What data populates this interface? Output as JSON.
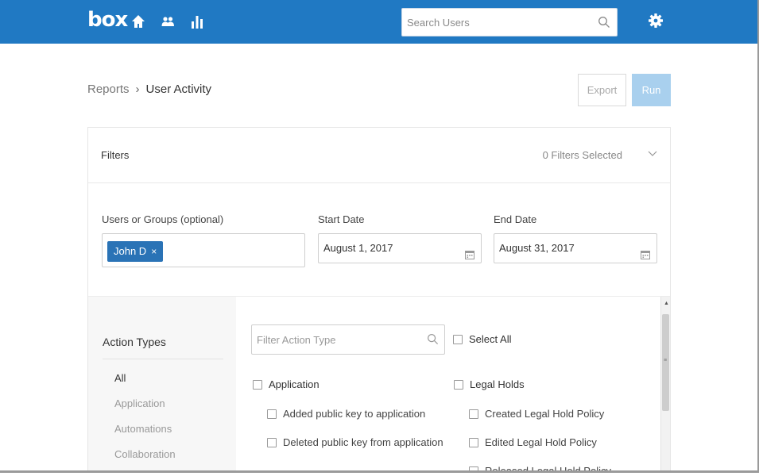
{
  "header": {
    "logo": "box",
    "search_placeholder": "Search Users",
    "icons": [
      "home-icon",
      "users-icon",
      "reports-icon",
      "gear-icon",
      "search-icon"
    ]
  },
  "breadcrumb": {
    "parent": "Reports",
    "separator": "›",
    "current": "User Activity"
  },
  "actions": {
    "export_label": "Export",
    "run_label": "Run"
  },
  "filters": {
    "title": "Filters",
    "selected_count": "0 Filters Selected",
    "users_label": "Users or Groups (optional)",
    "user_chip": "John D",
    "user_chip_remove": "×",
    "start_label": "Start Date",
    "start_value": "August 1, 2017",
    "end_label": "End Date",
    "end_value": "August 31, 2017"
  },
  "action_types": {
    "title": "Action Types",
    "items": [
      {
        "label": "All",
        "active": true
      },
      {
        "label": "Application",
        "active": false
      },
      {
        "label": "Automations",
        "active": false
      },
      {
        "label": "Collaboration",
        "active": false
      }
    ],
    "filter_placeholder": "Filter Action Type",
    "select_all": "Select All",
    "groups": [
      {
        "label": "Application",
        "children": [
          "Added public key to application",
          "Deleted public key from application"
        ]
      },
      {
        "label": "Legal Holds",
        "children": [
          "Created Legal Hold Policy",
          "Edited Legal Hold Policy",
          "Released Legal Hold Policy"
        ]
      }
    ]
  },
  "colors": {
    "brand_blue": "#2079c3",
    "run_button": "#a9d0ee",
    "chip": "#2a73b6"
  }
}
